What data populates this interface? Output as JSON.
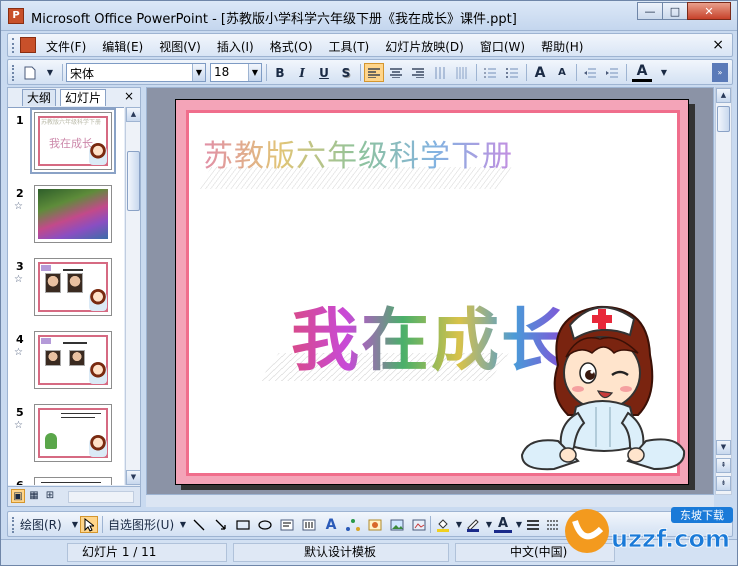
{
  "window": {
    "title": "Microsoft Office PowerPoint - [苏教版小学科学六年级下册《我在成长》课件.ppt]",
    "minimize": "—",
    "maximize": "□",
    "close": "✕",
    "app_icon": "P"
  },
  "menubar": {
    "items": [
      "文件(F)",
      "编辑(E)",
      "视图(V)",
      "插入(I)",
      "格式(O)",
      "工具(T)",
      "幻灯片放映(D)",
      "窗口(W)",
      "帮助(H)"
    ],
    "close": "×"
  },
  "toolbar": {
    "font_name": "宋体",
    "font_size": "18",
    "bold": "B",
    "italic": "I",
    "underline": "U",
    "shadow": "S",
    "increase_font": "A",
    "decrease_font": "A",
    "font_color": "A"
  },
  "sidepane": {
    "tabs": [
      "大纲",
      "幻灯片"
    ],
    "close": "×",
    "slides": [
      {
        "number": "1",
        "thumb_title": "苏教版六年级科学下册",
        "thumb_big": "我在成长"
      },
      {
        "number": "2"
      },
      {
        "number": "3"
      },
      {
        "number": "4"
      },
      {
        "number": "5"
      },
      {
        "number": "6"
      }
    ]
  },
  "slide": {
    "title": "苏教版六年级科学下册",
    "big_text": "我在成长"
  },
  "drawbar": {
    "draw_label": "绘图(R)",
    "autoshapes_label": "自选图形(U)"
  },
  "statusbar": {
    "slide_info": "幻灯片 1 / 11",
    "design": "默认设计模板",
    "language": "中文(中国)"
  },
  "watermark": {
    "brand": "uzzf.com",
    "tag": "东坡下载"
  }
}
